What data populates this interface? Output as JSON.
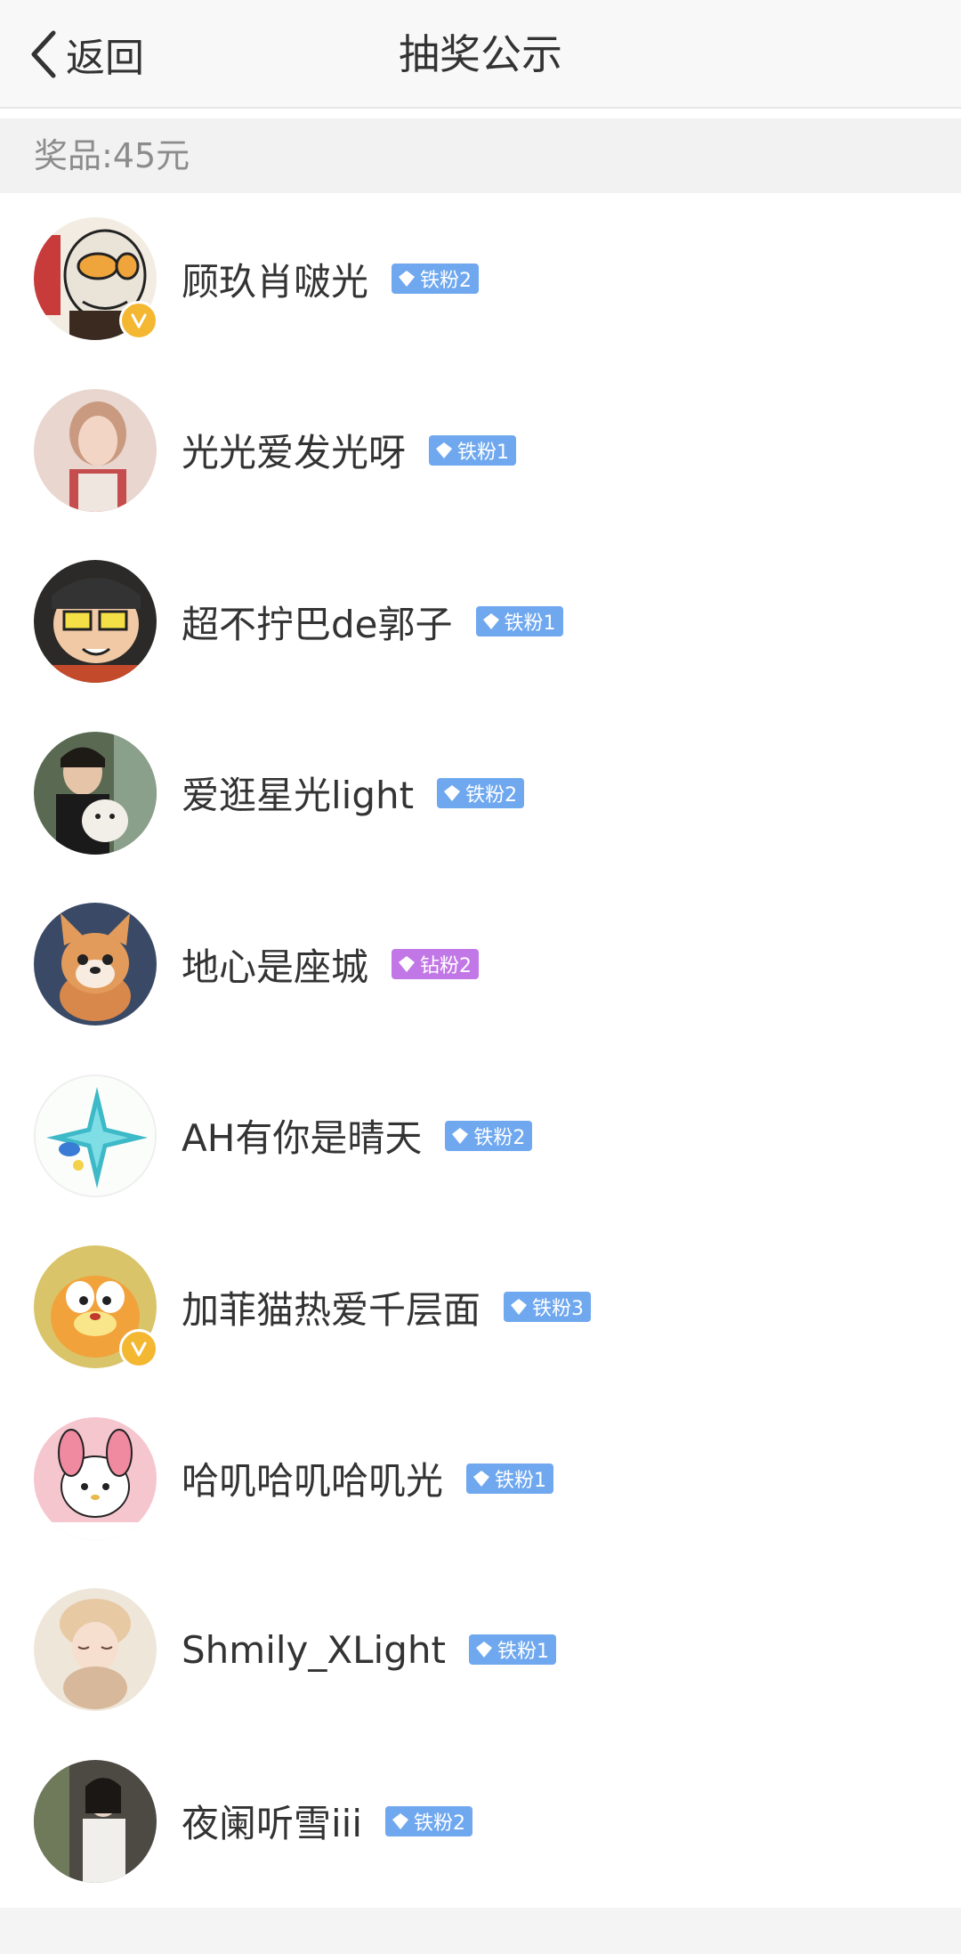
{
  "header": {
    "back_label": "返回",
    "title": "抽奖公示"
  },
  "prize": {
    "label": "奖品:45元"
  },
  "winners": [
    {
      "name": "顾玖肖啵光",
      "badge": "铁粉2",
      "badge_color": "#6fa8ef",
      "verified": true
    },
    {
      "name": "光光爱发光呀",
      "badge": "铁粉1",
      "badge_color": "#6fa8ef",
      "verified": false
    },
    {
      "name": "超不拧巴de郭子",
      "badge": "铁粉1",
      "badge_color": "#6fa8ef",
      "verified": false
    },
    {
      "name": "爱逛星光light",
      "badge": "铁粉2",
      "badge_color": "#6fa8ef",
      "verified": false
    },
    {
      "name": "地心是座城",
      "badge": "钻粉2",
      "badge_color": "#c277e6",
      "verified": false
    },
    {
      "name": "AH有你是晴天",
      "badge": "铁粉2",
      "badge_color": "#6fa8ef",
      "verified": false
    },
    {
      "name": "加菲猫热爱千层面",
      "badge": "铁粉3",
      "badge_color": "#6fa8ef",
      "verified": true
    },
    {
      "name": "哈叽哈叽哈叽光",
      "badge": "铁粉1",
      "badge_color": "#6fa8ef",
      "verified": false
    },
    {
      "name": "Shmily_XLight",
      "badge": "铁粉1",
      "badge_color": "#6fa8ef",
      "verified": false
    },
    {
      "name": "夜阑听雪iii",
      "badge": "铁粉2",
      "badge_color": "#6fa8ef",
      "verified": false
    }
  ]
}
